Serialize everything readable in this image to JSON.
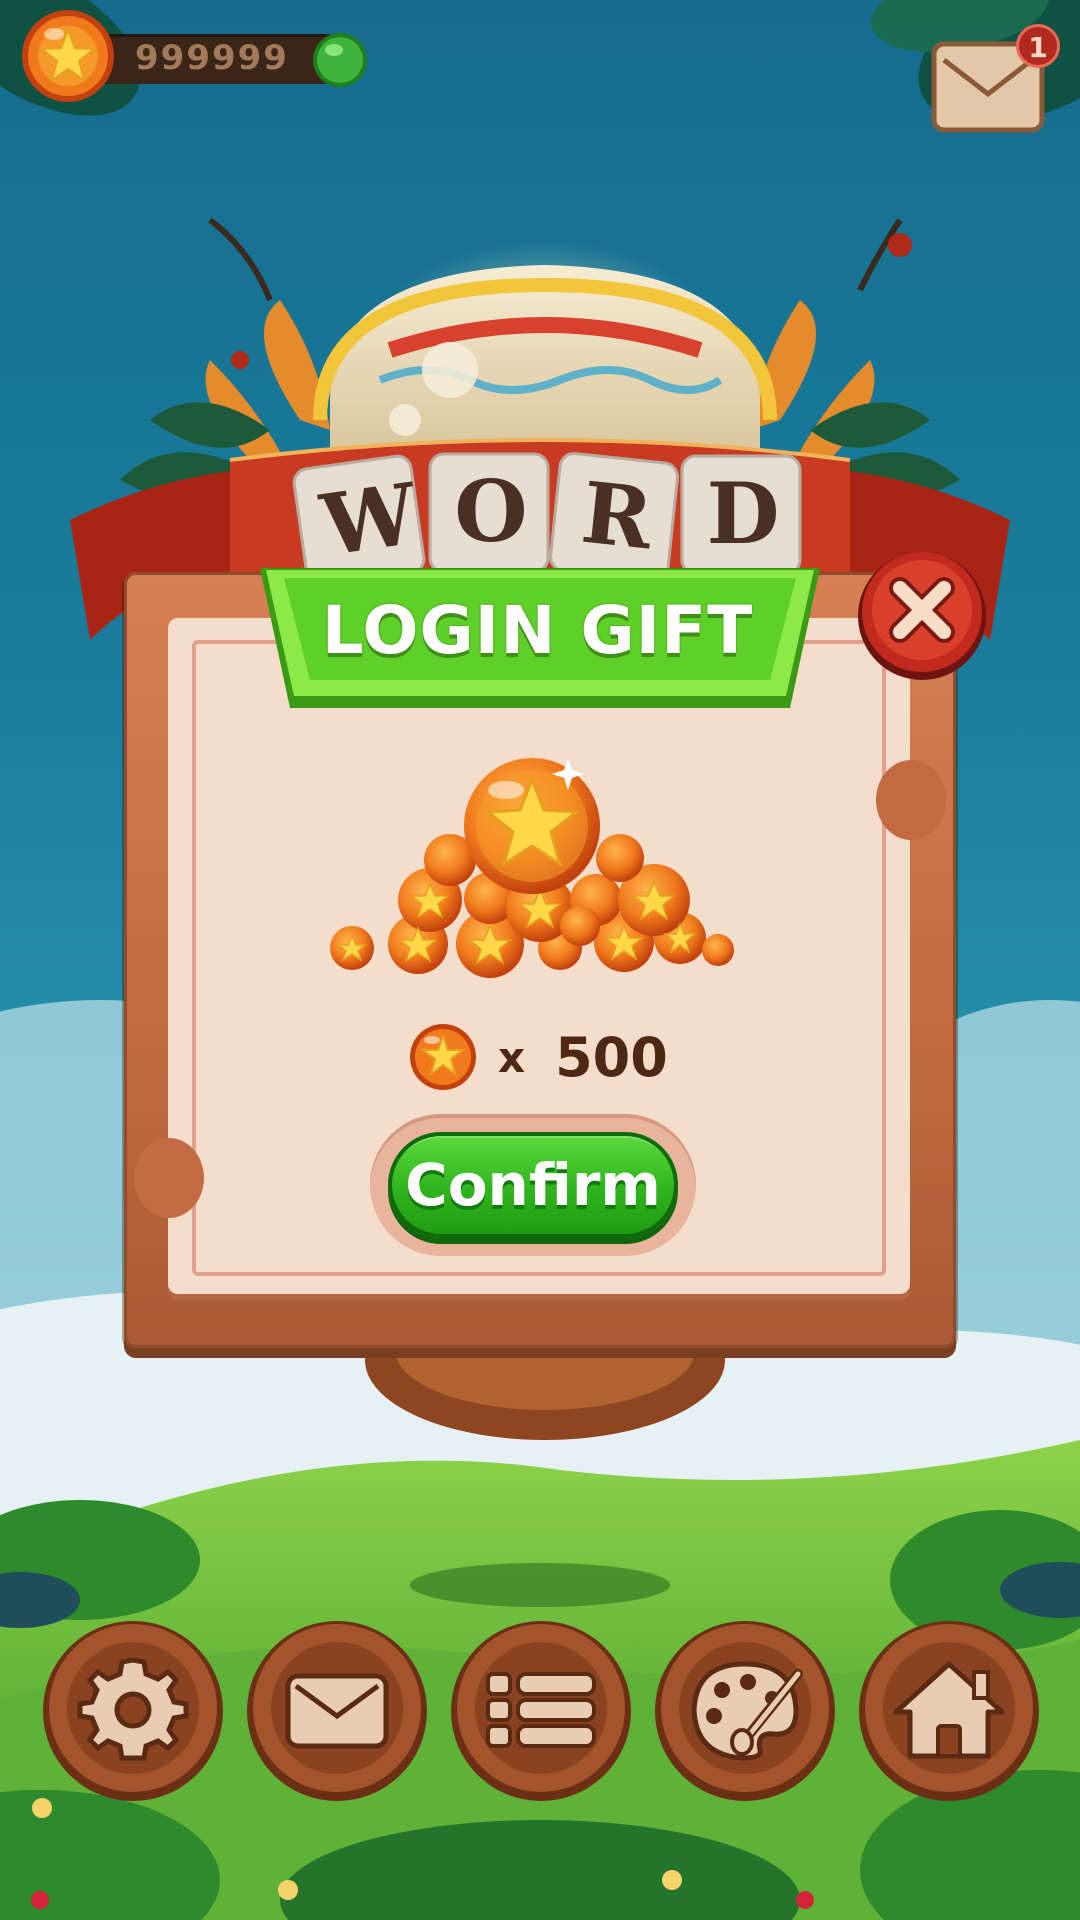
{
  "topbar": {
    "currency_value": "999999",
    "mail_badge_count": "1"
  },
  "game_logo": {
    "letters": [
      "W",
      "O",
      "R",
      "D"
    ]
  },
  "dialog": {
    "title": "LOGIN GIFT",
    "reward_multiplier": "x",
    "reward_amount": "500",
    "confirm_label": "Confirm"
  },
  "bottom_nav": {
    "items": [
      {
        "icon": "gear-icon"
      },
      {
        "icon": "mail-icon"
      },
      {
        "icon": "list-icon"
      },
      {
        "icon": "palette-icon"
      },
      {
        "icon": "home-icon"
      }
    ]
  },
  "colors": {
    "sky": "#166c8e",
    "dialog_frame": "#c26b41",
    "dialog_panel": "#f5ddcc",
    "banner_green": "#6fd63a",
    "confirm_green": "#2fb41d",
    "close_red": "#b8231b",
    "text_brown": "#4d2815"
  }
}
